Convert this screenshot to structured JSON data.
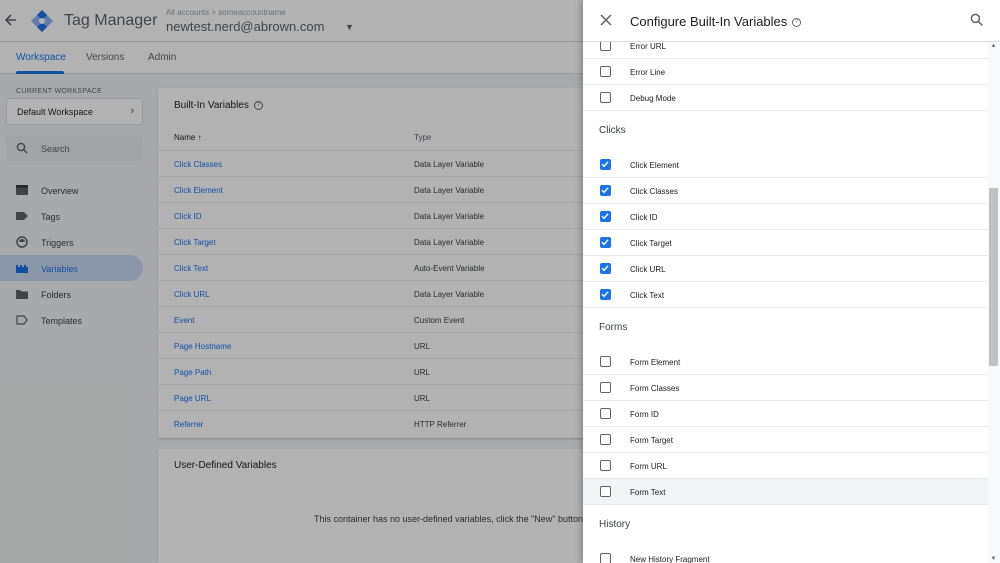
{
  "app": {
    "title": "Tag Manager",
    "account_label": "All accounts > someaccountname",
    "account_name": "newtest.nerd@abrown.com"
  },
  "nav": {
    "tabs": [
      "Workspace",
      "Versions",
      "Admin"
    ],
    "active": "Workspace"
  },
  "sidebar": {
    "current_workspace_label": "CURRENT WORKSPACE",
    "workspace_name": "Default Workspace",
    "search_placeholder": "Search",
    "items": [
      {
        "label": "Overview",
        "icon": "overview-icon"
      },
      {
        "label": "Tags",
        "icon": "tag-icon"
      },
      {
        "label": "Triggers",
        "icon": "trigger-icon"
      },
      {
        "label": "Variables",
        "icon": "variables-icon",
        "active": true
      },
      {
        "label": "Folders",
        "icon": "folder-icon"
      },
      {
        "label": "Templates",
        "icon": "template-icon"
      }
    ]
  },
  "builtin": {
    "title": "Built-In Variables",
    "col_name": "Name",
    "col_type": "Type",
    "rows": [
      {
        "name": "Click Classes",
        "type": "Data Layer Variable"
      },
      {
        "name": "Click Element",
        "type": "Data Layer Variable"
      },
      {
        "name": "Click ID",
        "type": "Data Layer Variable"
      },
      {
        "name": "Click Target",
        "type": "Data Layer Variable"
      },
      {
        "name": "Click Text",
        "type": "Auto-Event Variable"
      },
      {
        "name": "Click URL",
        "type": "Data Layer Variable"
      },
      {
        "name": "Event",
        "type": "Custom Event"
      },
      {
        "name": "Page Hostname",
        "type": "URL"
      },
      {
        "name": "Page Path",
        "type": "URL"
      },
      {
        "name": "Page URL",
        "type": "URL"
      },
      {
        "name": "Referrer",
        "type": "HTTP Referrer"
      }
    ]
  },
  "userdefined": {
    "title": "User-Defined Variables",
    "empty_message": "This container has no user-defined variables, click the \"New\" button"
  },
  "panel": {
    "title": "Configure Built-In Variables",
    "errors_rows": [
      {
        "label": "Error URL",
        "checked": false
      },
      {
        "label": "Error Line",
        "checked": false
      },
      {
        "label": "Debug Mode",
        "checked": false
      }
    ],
    "clicks": {
      "title": "Clicks",
      "rows": [
        {
          "label": "Click Element",
          "checked": true
        },
        {
          "label": "Click Classes",
          "checked": true
        },
        {
          "label": "Click ID",
          "checked": true
        },
        {
          "label": "Click Target",
          "checked": true
        },
        {
          "label": "Click URL",
          "checked": true
        },
        {
          "label": "Click Text",
          "checked": true
        }
      ]
    },
    "forms": {
      "title": "Forms",
      "rows": [
        {
          "label": "Form Element",
          "checked": false
        },
        {
          "label": "Form Classes",
          "checked": false
        },
        {
          "label": "Form ID",
          "checked": false
        },
        {
          "label": "Form Target",
          "checked": false
        },
        {
          "label": "Form URL",
          "checked": false
        },
        {
          "label": "Form Text",
          "checked": false
        }
      ]
    },
    "history": {
      "title": "History",
      "rows": [
        {
          "label": "New History Fragment",
          "checked": false
        }
      ]
    }
  },
  "colors": {
    "accent": "#1a73e8",
    "active_nav_bg": "#c7d7f2",
    "scrim": "rgba(0,0,0,0.3)"
  }
}
